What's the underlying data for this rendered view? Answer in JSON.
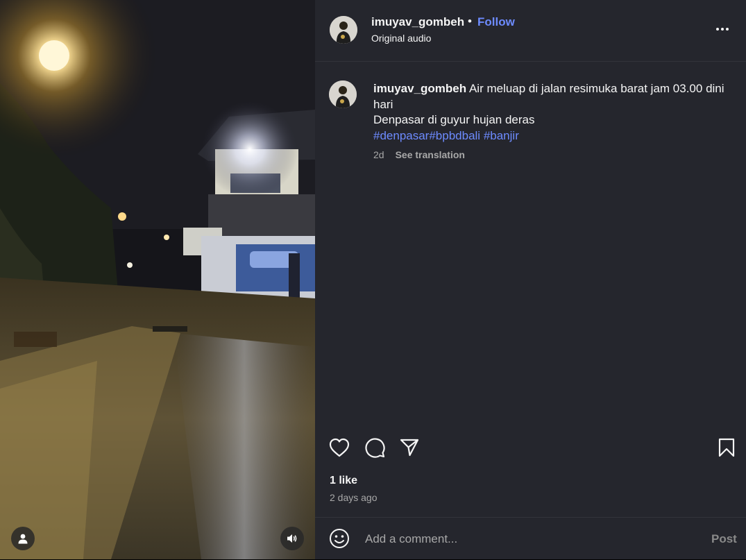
{
  "post": {
    "username": "imuyav_gombeh",
    "separator": "•",
    "follow_label": "Follow",
    "audio_label": "Original audio"
  },
  "caption": {
    "username": "imuyav_gombeh",
    "line1": "Air meluap di jalan resimuka barat jam 03.00 dini hari",
    "line2": "Denpasar di guyur hujan deras",
    "hashtags": [
      "#denpasar",
      "#bpbdbali",
      " #banjir"
    ],
    "age": "2d",
    "see_translation": "See translation"
  },
  "stats": {
    "likes": "1 like",
    "time_ago": "2 days ago"
  },
  "comment": {
    "placeholder": "Add a comment...",
    "post_label": "Post"
  },
  "icons": {
    "more": "more-options-icon",
    "like": "heart-icon",
    "comment": "comment-icon",
    "share": "send-icon",
    "save": "bookmark-icon",
    "emoji": "emoji-icon",
    "user": "user-icon",
    "audio": "speaker-icon"
  },
  "colors": {
    "panel_bg": "#25262d",
    "link_blue": "#6d8bff",
    "muted_text": "#a8a8a8"
  }
}
